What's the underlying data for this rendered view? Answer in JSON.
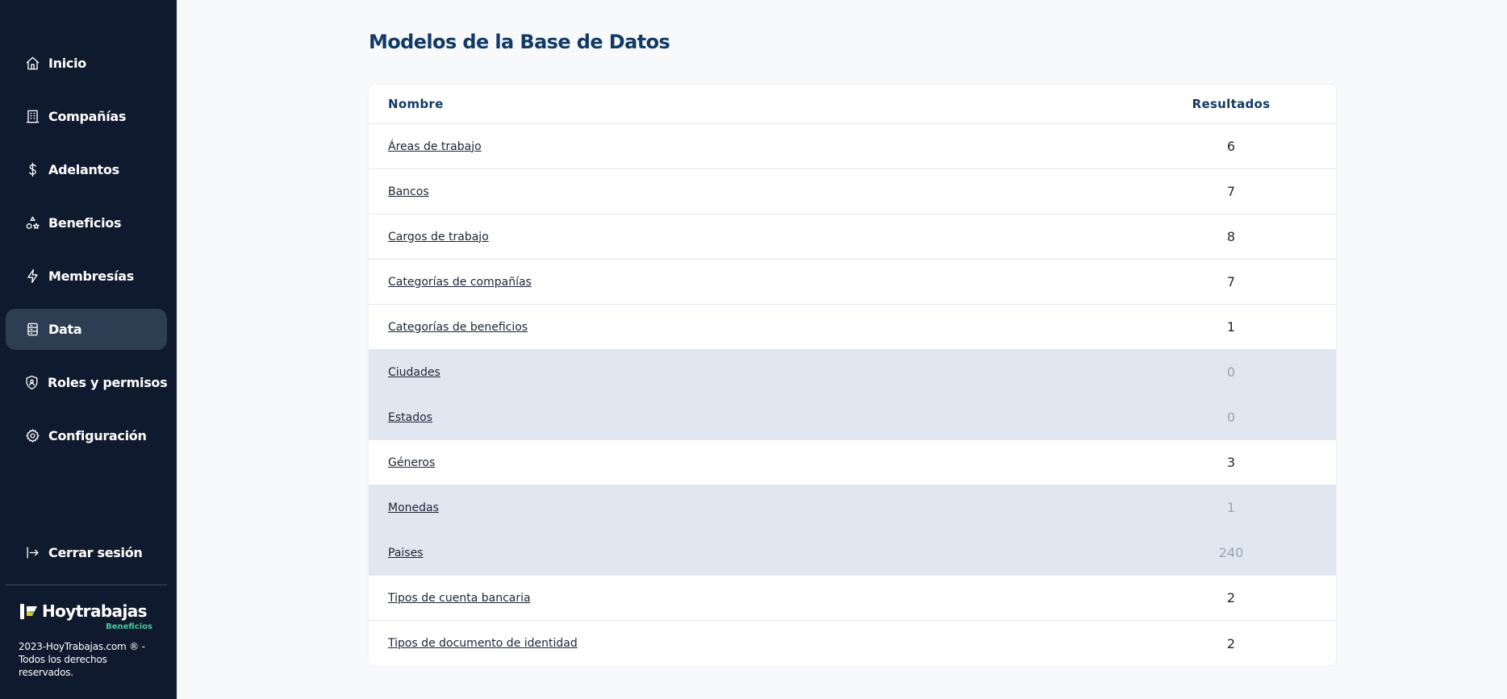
{
  "sidebar": {
    "items": [
      {
        "label": "Inicio",
        "icon": "home-icon",
        "active": false
      },
      {
        "label": "Compañías",
        "icon": "building-icon",
        "active": false
      },
      {
        "label": "Adelantos",
        "icon": "dollar-icon",
        "active": false
      },
      {
        "label": "Beneficios",
        "icon": "shapes-icon",
        "active": false
      },
      {
        "label": "Membresías",
        "icon": "bolt-icon",
        "active": false
      },
      {
        "label": "Data",
        "icon": "database-icon",
        "active": true
      },
      {
        "label": "Roles y permisos",
        "icon": "shield-icon",
        "active": false
      },
      {
        "label": "Configuración",
        "icon": "gear-icon",
        "active": false
      }
    ],
    "logout_label": "Cerrar sesión",
    "brand": {
      "name": "Hoytrabajas",
      "sub": "Beneficios"
    },
    "copyright": "2023-HoyTrabajas.com ® - Todos los derechos reservados."
  },
  "main": {
    "title": "Modelos de la Base de Datos",
    "table": {
      "headers": {
        "name": "Nombre",
        "results": "Resultados"
      },
      "rows": [
        {
          "name": "Áreas de trabajo",
          "results": "6",
          "muted": false
        },
        {
          "name": "Bancos",
          "results": "7",
          "muted": false
        },
        {
          "name": "Cargos de trabajo",
          "results": "8",
          "muted": false
        },
        {
          "name": "Categorías de compañías",
          "results": "7",
          "muted": false
        },
        {
          "name": "Categorías de beneficios",
          "results": "1",
          "muted": false
        },
        {
          "name": "Ciudades",
          "results": "0",
          "muted": true
        },
        {
          "name": "Estados",
          "results": "0",
          "muted": true
        },
        {
          "name": "Géneros",
          "results": "3",
          "muted": false
        },
        {
          "name": "Monedas",
          "results": "1",
          "muted": true
        },
        {
          "name": "Paises",
          "results": "240",
          "muted": true
        },
        {
          "name": "Tipos de cuenta bancaria",
          "results": "2",
          "muted": false
        },
        {
          "name": "Tipos de documento de identidad",
          "results": "2",
          "muted": false
        }
      ]
    }
  },
  "colors": {
    "sidebar_bg": "#101a2e",
    "active_item_bg": "#2d3e52",
    "title": "#123a64",
    "muted_row_bg": "#e1e7f1",
    "brand_accent": "#47c89a"
  }
}
